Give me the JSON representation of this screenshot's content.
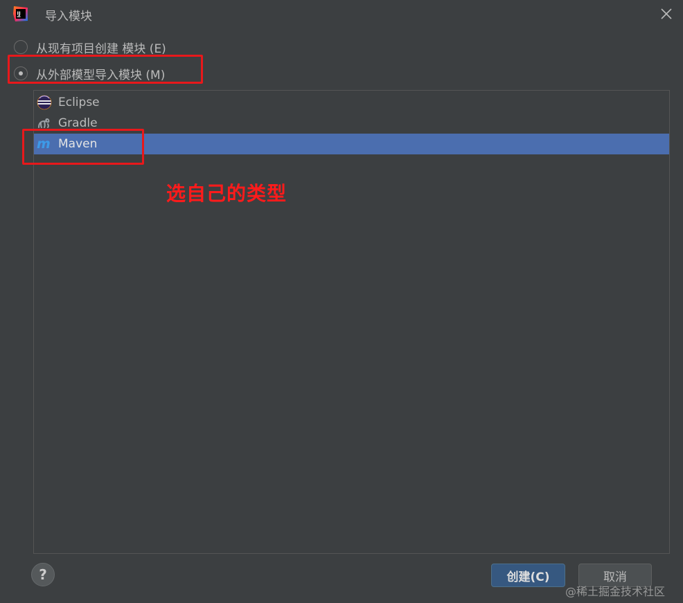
{
  "window": {
    "title": "导入模块",
    "app_icon": "intellij-idea-icon",
    "close_icon": "close-icon"
  },
  "options": [
    {
      "label": "从现有项目创建 模块 (E)",
      "checked": false
    },
    {
      "label": "从外部模型导入模块 (M)",
      "checked": true
    }
  ],
  "list": {
    "items": [
      {
        "label": "Eclipse",
        "icon": "eclipse-icon",
        "selected": false
      },
      {
        "label": "Gradle",
        "icon": "gradle-icon",
        "selected": false
      },
      {
        "label": "Maven",
        "icon": "maven-icon",
        "selected": true
      }
    ]
  },
  "annotation": {
    "text": "选自己的类型",
    "color": "#e8181b"
  },
  "footer": {
    "help_label": "?",
    "create_label": "创建(C)",
    "cancel_label": "取消"
  },
  "watermark": "@稀土掘金技术社区",
  "colors": {
    "background": "#3c3f41",
    "selection": "#4b6eaf",
    "primary_button": "#365880"
  }
}
